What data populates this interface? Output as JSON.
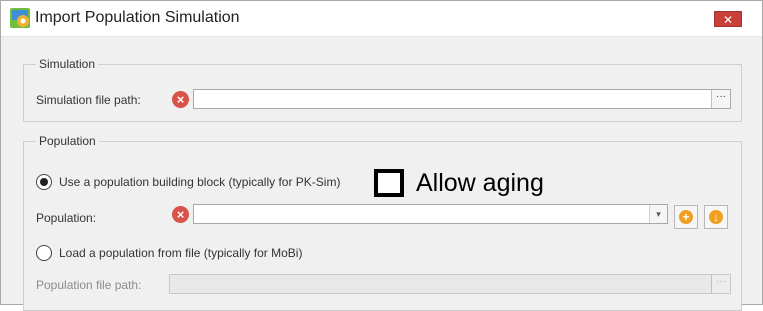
{
  "window": {
    "title": "Import Population Simulation",
    "close_glyph": "✕",
    "app_icon": "population-simulation-icon"
  },
  "simulation_group": {
    "title": "Simulation",
    "file_path_label": "Simulation file path:",
    "file_path_value": "",
    "browse_glyph": "···",
    "error_icon": "error-icon"
  },
  "population_group": {
    "title": "Population",
    "use_building_block_label": "Use a population building block (typically for PK-Sim)",
    "use_building_block_checked": true,
    "allow_aging_label": "Allow aging",
    "allow_aging_checked": false,
    "population_label": "Population:",
    "population_value": "",
    "dropdown_glyph": "▾",
    "add_glyph": "+",
    "load_glyph": "↓",
    "load_from_file_label": "Load a population from file (typically for MoBi)",
    "load_from_file_checked": false,
    "population_file_path_label": "Population file path:",
    "population_file_path_value": "",
    "browse_glyph": "···"
  }
}
